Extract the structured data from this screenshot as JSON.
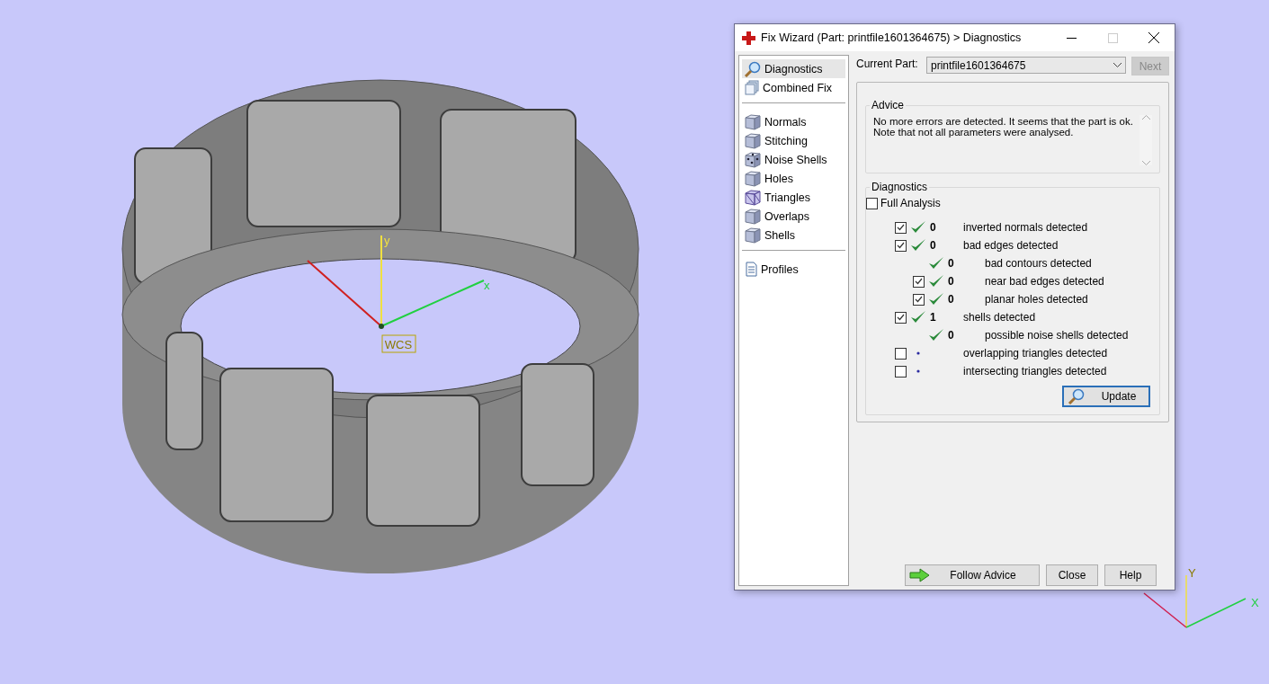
{
  "viewport": {
    "wcs_axes": {
      "y": "y",
      "x": "x",
      "label": "WCS"
    },
    "corner_axes": {
      "y": "Y",
      "x": "X"
    }
  },
  "dialog": {
    "title": "Fix Wizard (Part: printfile1601364675) > Diagnostics",
    "sidebar": {
      "groups": [
        {
          "items": [
            {
              "label": "Diagnostics",
              "kind": "search",
              "selected": true
            },
            {
              "label": "Combined Fix",
              "kind": "stack",
              "selected": false
            }
          ]
        },
        {
          "items": [
            {
              "label": "Normals",
              "kind": "cube",
              "selected": false
            },
            {
              "label": "Stitching",
              "kind": "cube",
              "selected": false
            },
            {
              "label": "Noise Shells",
              "kind": "dice",
              "selected": false
            },
            {
              "label": "Holes",
              "kind": "cube",
              "selected": false
            },
            {
              "label": "Triangles",
              "kind": "wire",
              "selected": false
            },
            {
              "label": "Overlaps",
              "kind": "cube",
              "selected": false
            },
            {
              "label": "Shells",
              "kind": "cube",
              "selected": false
            }
          ]
        },
        {
          "items": [
            {
              "label": "Profiles",
              "kind": "document",
              "selected": false
            }
          ]
        }
      ]
    },
    "current_part": {
      "label": "Current Part:",
      "value": "printfile1601364675"
    },
    "next_button": {
      "label": "Next",
      "disabled": true
    },
    "advice": {
      "title": "Advice",
      "text": "No more errors are detected. It seems that the part is ok.\nNote that not all parameters were analysed."
    },
    "diagnostics": {
      "title": "Diagnostics",
      "full_analysis": {
        "label": "Full Analysis",
        "checked": false
      },
      "checks": [
        {
          "label": "inverted normals detected",
          "kind": "checkbox",
          "checked": true,
          "ok": true,
          "count": "0"
        },
        {
          "label": "bad edges detected",
          "kind": "checkbox",
          "checked": true,
          "ok": true,
          "count": "0",
          "children": [
            {
              "label": "bad contours detected",
              "kind": "info",
              "ok": true,
              "count": "0"
            },
            {
              "label": "near bad edges detected",
              "kind": "checkbox",
              "checked": true,
              "ok": true,
              "count": "0"
            },
            {
              "label": "planar holes detected",
              "kind": "checkbox",
              "checked": true,
              "ok": true,
              "count": "0"
            }
          ]
        },
        {
          "label": "shells detected",
          "kind": "checkbox",
          "checked": true,
          "ok": true,
          "count": "1",
          "children": [
            {
              "label": "possible noise shells detected",
              "kind": "info",
              "ok": true,
              "count": "0"
            }
          ]
        },
        {
          "label": "overlapping triangles detected",
          "kind": "checkbox",
          "checked": false,
          "ok": false
        },
        {
          "label": "intersecting triangles detected",
          "kind": "checkbox",
          "checked": false,
          "ok": false
        }
      ],
      "update_button": {
        "label": "Update",
        "focused": true
      }
    },
    "buttons": [
      {
        "label": "Follow Advice",
        "kind": "advice"
      },
      {
        "label": "Close",
        "kind": "plain"
      },
      {
        "label": "Help",
        "kind": "plain"
      }
    ]
  }
}
